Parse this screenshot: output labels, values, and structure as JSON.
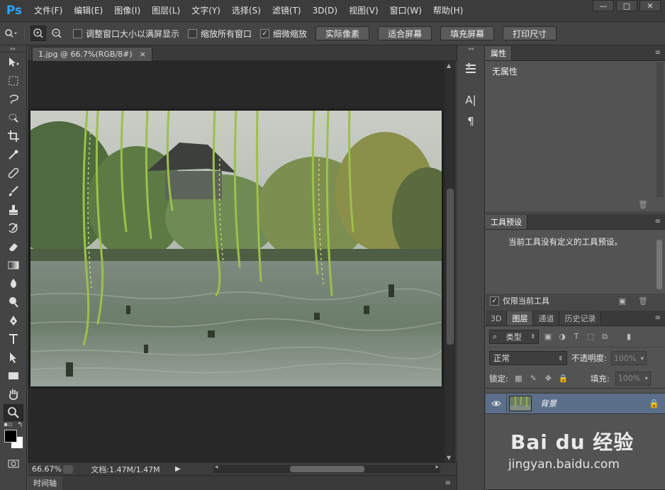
{
  "app": {
    "logo": "Ps"
  },
  "menu": [
    "文件(F)",
    "编辑(E)",
    "图像(I)",
    "图层(L)",
    "文字(Y)",
    "选择(S)",
    "滤镜(T)",
    "3D(D)",
    "视图(V)",
    "窗口(W)",
    "帮助(H)"
  ],
  "window_controls": [
    "—",
    "□",
    "✕"
  ],
  "options": {
    "checkboxes": [
      {
        "label": "调整窗口大小以满屏显示",
        "checked": false
      },
      {
        "label": "缩放所有窗口",
        "checked": false
      },
      {
        "label": "细微缩放",
        "checked": true
      }
    ],
    "buttons": [
      "实际像素",
      "适合屏幕",
      "填充屏幕",
      "打印尺寸"
    ]
  },
  "document": {
    "tab_title": "1.jpg @ 66.7%(RGB/8#)",
    "tab_close": "×",
    "zoom": "66.67%",
    "doc_info": "文档:1.47M/1.47M"
  },
  "timeline": {
    "label": "时间轴"
  },
  "properties": {
    "tab": "属性",
    "content": "无属性"
  },
  "tool_presets": {
    "tab": "工具预设",
    "message": "当前工具没有定义的工具预设。",
    "only_current_label": "仅限当前工具",
    "only_current_checked": true
  },
  "layers": {
    "tabs": [
      "3D",
      "图层",
      "通道",
      "历史记录"
    ],
    "active_tab": "图层",
    "filter_label": "类型",
    "blend_mode": "正常",
    "opacity_label": "不透明度:",
    "opacity_value": "100%",
    "lock_label": "锁定:",
    "fill_label": "填充:",
    "fill_value": "100%",
    "items": [
      {
        "name": "背景",
        "visible": true,
        "locked": true
      }
    ]
  },
  "watermark": {
    "brand": "Bai du 经验",
    "url": "jingyan.baidu.com"
  },
  "colors": {
    "accent_logo": "#2fa3f5",
    "selected_layer": "#5b6f8a",
    "foreground": "#000000",
    "background": "#ffffff"
  }
}
